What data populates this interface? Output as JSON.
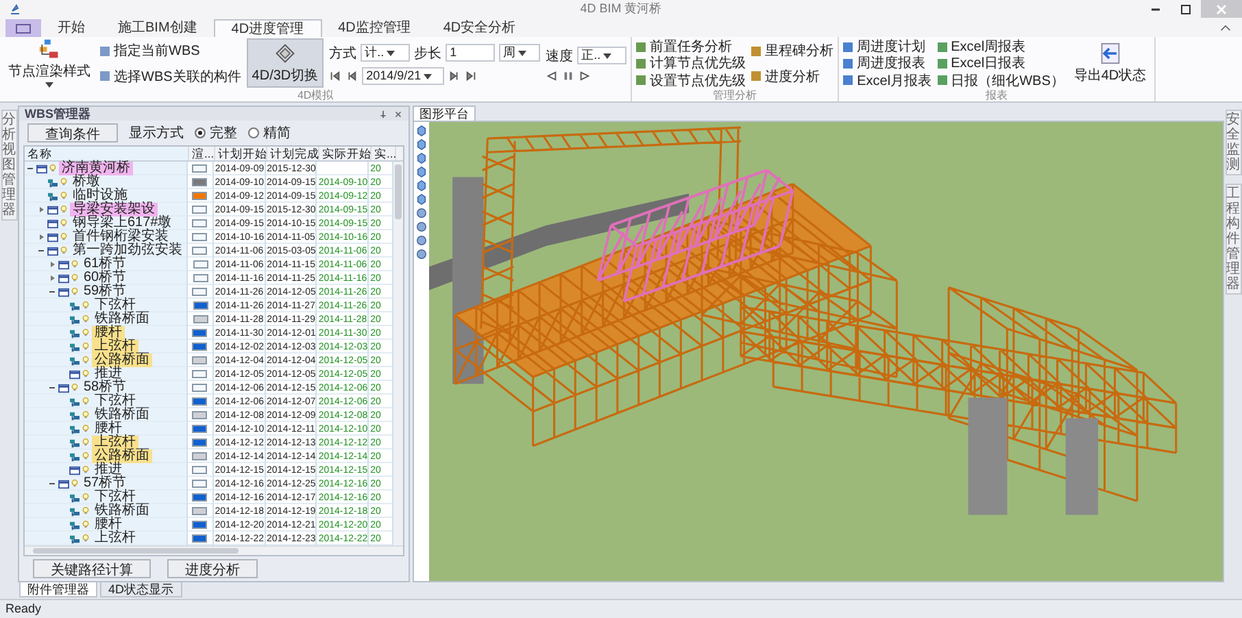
{
  "window": {
    "title": "4D BIM 黄河桥"
  },
  "ribbon_tabs": [
    {
      "label": "开始",
      "selected": false
    },
    {
      "label": "施工BIM创建",
      "selected": false
    },
    {
      "label": "4D进度管理",
      "selected": true
    },
    {
      "label": "4D监控管理",
      "selected": false
    },
    {
      "label": "4D安全分析",
      "selected": false
    }
  ],
  "ribbon": {
    "render_style_button": "节点渲染样式",
    "wbs_buttons": [
      "指定当前WBS",
      "选择WBS关联的构件"
    ],
    "switch_button": {
      "label": "4D/3D切换",
      "pressed": true
    },
    "mode": {
      "label": "方式",
      "value": "计.."
    },
    "step": {
      "label": "步长",
      "value": "1"
    },
    "unit": {
      "value": "周"
    },
    "speed": {
      "label": "速度",
      "value": "正.."
    },
    "date": {
      "value": "2014/9/21"
    },
    "simulation_group_label": "4D模拟",
    "analysis_buttons": [
      "前置任务分析",
      "计算节点优先级",
      "设置节点优先级",
      "里程碑分析",
      "进度分析"
    ],
    "analysis_group_label": "管理分析",
    "report_buttons": [
      "周进度计划",
      "周进度报表",
      "Excel月报表",
      "Excel周报表",
      "Excel日报表",
      "日报（细化WBS）"
    ],
    "report_group_label": "报表",
    "export_button": "导出4D状态"
  },
  "left_dock_tab": "分析视图管理器",
  "wbs_panel": {
    "title": "WBS管理器",
    "query_button": "查询条件",
    "display_label": "显示方式",
    "display_options": [
      {
        "label": "完整",
        "selected": true
      },
      {
        "label": "精简",
        "selected": false
      }
    ],
    "columns": [
      "名称",
      "渲...",
      "计划开始",
      "计划完成",
      "实际开始",
      "实..."
    ],
    "tree": [
      {
        "name": "济南黄河桥",
        "kind": "group",
        "expanded": true,
        "highlighted": true,
        "color": "#f4f8fc",
        "plan_start": "2014-09-09",
        "plan_end": "2015-12-30",
        "actual_end": "20",
        "children": [
          {
            "name": "桥墩",
            "kind": "element",
            "highlighted": false,
            "color": "#7a7a7a",
            "plan_start": "2014-09-10",
            "plan_end": "2014-09-15",
            "actual_start": "2014-09-10",
            "actual_end": "20"
          },
          {
            "name": "临时设施",
            "kind": "element",
            "highlighted": false,
            "color": "#f07800",
            "plan_start": "2014-09-12",
            "plan_end": "2014-09-15",
            "actual_start": "2014-09-12",
            "actual_end": "20"
          },
          {
            "name": "导梁安装架设",
            "kind": "group",
            "expanded": false,
            "highlighted": true,
            "color": "#f4f8fc",
            "plan_start": "2014-09-15",
            "plan_end": "2015-12-30",
            "actual_start": "2014-09-15",
            "actual_end": "20"
          },
          {
            "name": "钢导梁上617#墩",
            "kind": "group",
            "highlighted": false,
            "color": "#f4f8fc",
            "plan_start": "2014-09-15",
            "plan_end": "2014-10-15",
            "actual_start": "2014-09-15",
            "actual_end": "20"
          },
          {
            "name": "首件钢桁梁安装",
            "kind": "group",
            "expanded": false,
            "highlighted": false,
            "color": "#f4f8fc",
            "plan_start": "2014-10-16",
            "plan_end": "2014-11-05",
            "actual_start": "2014-10-16",
            "actual_end": "20"
          },
          {
            "name": "第一跨加劲弦安装",
            "kind": "group",
            "expanded": true,
            "highlighted": false,
            "color": "#f4f8fc",
            "plan_start": "2014-11-06",
            "plan_end": "2015-03-05",
            "actual_start": "2014-11-06",
            "actual_end": "20",
            "children": [
              {
                "name": "61桥节",
                "kind": "group",
                "expanded": false,
                "highlighted": false,
                "color": "#f4f8fc",
                "plan_start": "2014-11-06",
                "plan_end": "2014-11-15",
                "actual_start": "2014-11-06",
                "actual_end": "20"
              },
              {
                "name": "60桥节",
                "kind": "group",
                "expanded": false,
                "highlighted": false,
                "color": "#f4f8fc",
                "plan_start": "2014-11-16",
                "plan_end": "2014-11-25",
                "actual_start": "2014-11-16",
                "actual_end": "20"
              },
              {
                "name": "59桥节",
                "kind": "group",
                "expanded": true,
                "highlighted": false,
                "color": "#f4f8fc",
                "plan_start": "2014-11-26",
                "plan_end": "2014-12-05",
                "actual_start": "2014-11-26",
                "actual_end": "20",
                "children": [
                  {
                    "name": "下弦杆",
                    "kind": "element",
                    "highlighted": false,
                    "color": "#1060d0",
                    "plan_start": "2014-11-26",
                    "plan_end": "2014-11-27",
                    "actual_start": "2014-11-26",
                    "actual_end": "20"
                  },
                  {
                    "name": "铁路桥面",
                    "kind": "element",
                    "highlighted": false,
                    "color": "#d0d0d4",
                    "plan_start": "2014-11-28",
                    "plan_end": "2014-11-29",
                    "actual_start": "2014-11-28",
                    "actual_end": "20"
                  },
                  {
                    "name": "腰杆",
                    "kind": "element",
                    "highlighted": true,
                    "color": "#1060d0",
                    "plan_start": "2014-11-30",
                    "plan_end": "2014-12-01",
                    "actual_start": "2014-11-30",
                    "actual_end": "20"
                  },
                  {
                    "name": "上弦杆",
                    "kind": "element",
                    "highlighted": true,
                    "color": "#1060d0",
                    "plan_start": "2014-12-02",
                    "plan_end": "2014-12-03",
                    "actual_start": "2014-12-03",
                    "actual_end": "20"
                  },
                  {
                    "name": "公路桥面",
                    "kind": "element",
                    "highlighted": true,
                    "color": "#d0d0d4",
                    "plan_start": "2014-12-04",
                    "plan_end": "2014-12-04",
                    "actual_start": "2014-12-05",
                    "actual_end": "20"
                  },
                  {
                    "name": "推进",
                    "kind": "group",
                    "highlighted": false,
                    "color": "#f4f8fc",
                    "plan_start": "2014-12-05",
                    "plan_end": "2014-12-05",
                    "actual_start": "2014-12-05",
                    "actual_end": "20"
                  }
                ]
              },
              {
                "name": "58桥节",
                "kind": "group",
                "expanded": true,
                "highlighted": false,
                "color": "#f4f8fc",
                "plan_start": "2014-12-06",
                "plan_end": "2014-12-15",
                "actual_start": "2014-12-06",
                "actual_end": "20",
                "children": [
                  {
                    "name": "下弦杆",
                    "kind": "element",
                    "highlighted": false,
                    "color": "#1060d0",
                    "plan_start": "2014-12-06",
                    "plan_end": "2014-12-07",
                    "actual_start": "2014-12-06",
                    "actual_end": "20"
                  },
                  {
                    "name": "铁路桥面",
                    "kind": "element",
                    "highlighted": false,
                    "color": "#d0d0d4",
                    "plan_start": "2014-12-08",
                    "plan_end": "2014-12-09",
                    "actual_start": "2014-12-08",
                    "actual_end": "20"
                  },
                  {
                    "name": "腰杆",
                    "kind": "element",
                    "highlighted": false,
                    "color": "#1060d0",
                    "plan_start": "2014-12-10",
                    "plan_end": "2014-12-11",
                    "actual_start": "2014-12-10",
                    "actual_end": "20"
                  },
                  {
                    "name": "上弦杆",
                    "kind": "element",
                    "highlighted": true,
                    "color": "#1060d0",
                    "plan_start": "2014-12-12",
                    "plan_end": "2014-12-13",
                    "actual_start": "2014-12-12",
                    "actual_end": "20"
                  },
                  {
                    "name": "公路桥面",
                    "kind": "element",
                    "highlighted": true,
                    "color": "#d0d0d4",
                    "plan_start": "2014-12-14",
                    "plan_end": "2014-12-14",
                    "actual_start": "2014-12-14",
                    "actual_end": "20"
                  },
                  {
                    "name": "推进",
                    "kind": "group",
                    "highlighted": false,
                    "color": "#f4f8fc",
                    "plan_start": "2014-12-15",
                    "plan_end": "2014-12-15",
                    "actual_start": "2014-12-15",
                    "actual_end": "20"
                  }
                ]
              },
              {
                "name": "57桥节",
                "kind": "group",
                "expanded": true,
                "highlighted": false,
                "color": "#f4f8fc",
                "plan_start": "2014-12-16",
                "plan_end": "2014-12-25",
                "actual_start": "2014-12-16",
                "actual_end": "20",
                "children": [
                  {
                    "name": "下弦杆",
                    "kind": "element",
                    "highlighted": false,
                    "color": "#1060d0",
                    "plan_start": "2014-12-16",
                    "plan_end": "2014-12-17",
                    "actual_start": "2014-12-16",
                    "actual_end": "20"
                  },
                  {
                    "name": "铁路桥面",
                    "kind": "element",
                    "highlighted": false,
                    "color": "#d0d0d4",
                    "plan_start": "2014-12-18",
                    "plan_end": "2014-12-19",
                    "actual_start": "2014-12-18",
                    "actual_end": "20"
                  },
                  {
                    "name": "腰杆",
                    "kind": "element",
                    "highlighted": false,
                    "color": "#1060d0",
                    "plan_start": "2014-12-20",
                    "plan_end": "2014-12-21",
                    "actual_start": "2014-12-20",
                    "actual_end": "20"
                  },
                  {
                    "name": "上弦杆",
                    "kind": "element",
                    "highlighted": false,
                    "color": "#1060d0",
                    "plan_start": "2014-12-22",
                    "plan_end": "2014-12-23",
                    "actual_start": "2014-12-22",
                    "actual_end": "20"
                  }
                ]
              }
            ]
          }
        ]
      }
    ],
    "buttons": [
      "关键路径计算",
      "进度分析"
    ]
  },
  "bottom_tabs": [
    {
      "label": "附件管理器",
      "selected": true
    },
    {
      "label": "4D状态显示",
      "selected": false
    }
  ],
  "viewport": {
    "tab": "图形平台"
  },
  "right_dock_tabs": [
    "安全监测",
    "工程构件管理器"
  ],
  "status_bar": {
    "text": "Ready"
  }
}
